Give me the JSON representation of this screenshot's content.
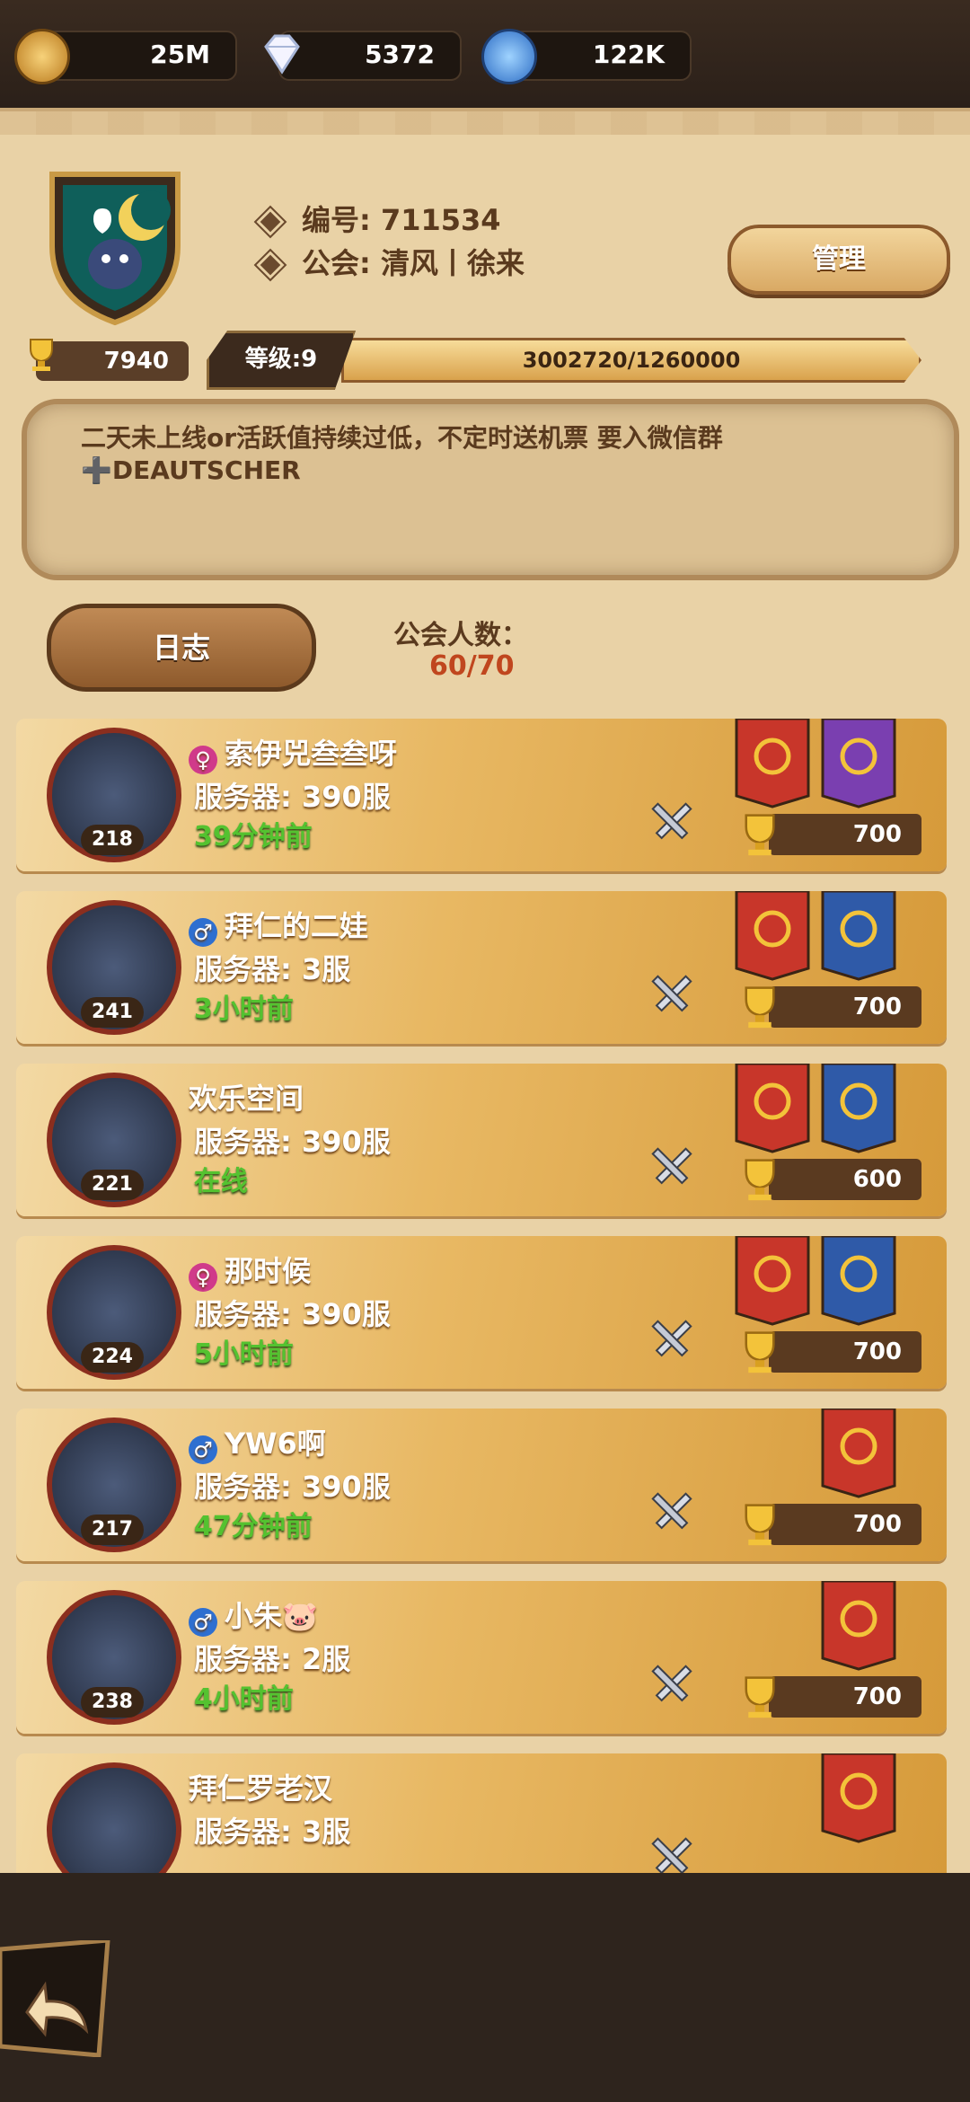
{
  "resources": [
    {
      "name": "gold",
      "value": "25M"
    },
    {
      "name": "diamonds",
      "value": "5372"
    },
    {
      "name": "dust",
      "value": "122K"
    }
  ],
  "guild": {
    "id_line": "编号: 711534",
    "guild_line": "公会: 清风丨徐来",
    "manage_label": "管理",
    "trophies": "7940",
    "level_label": "等级:9",
    "exp_text": "3002720/1260000",
    "notice_line1": "二天未上线or活跃值持续过低，不定时送机票 要入微信群",
    "notice_line2": "➕DEAUTSCHER",
    "log_label": "日志",
    "member_count_label": "公会人数：",
    "member_count_value": "60/70"
  },
  "members": [
    {
      "name": "索伊兕叁叁呀",
      "gender": "female",
      "gender_glyph": "♀",
      "server": "服务器: 390服",
      "status": "39分钟前",
      "level": "218",
      "score": "700"
    },
    {
      "name": "拜仁的二娃",
      "gender": "male",
      "gender_glyph": "♂",
      "server": "服务器: 3服",
      "status": "3小时前",
      "level": "241",
      "score": "700"
    },
    {
      "name": "欢乐空间",
      "gender": "",
      "gender_glyph": "",
      "server": "服务器: 390服",
      "status": "在线",
      "level": "221",
      "score": "600"
    },
    {
      "name": "那时候",
      "gender": "female",
      "gender_glyph": "♀",
      "server": "服务器: 390服",
      "status": "5小时前",
      "level": "224",
      "score": "700"
    },
    {
      "name": "YW6啊",
      "gender": "male",
      "gender_glyph": "♂",
      "server": "服务器: 390服",
      "status": "47分钟前",
      "level": "217",
      "score": "700"
    },
    {
      "name": "小朱🐷",
      "gender": "male",
      "gender_glyph": "♂",
      "server": "服务器: 2服",
      "status": "4小时前",
      "level": "238",
      "score": "700"
    },
    {
      "name": "拜仁罗老汉",
      "gender": "",
      "gender_glyph": "",
      "server": "服务器: 3服",
      "status": "",
      "level": "",
      "score": ""
    }
  ],
  "colors": {
    "parchment": "#e9d2a6",
    "online_green": "#54c230",
    "count_red": "#c0461e",
    "banner_red": "#c8362a",
    "banner_blue": "#2f5aa8",
    "banner_purple": "#7a3fb0"
  }
}
